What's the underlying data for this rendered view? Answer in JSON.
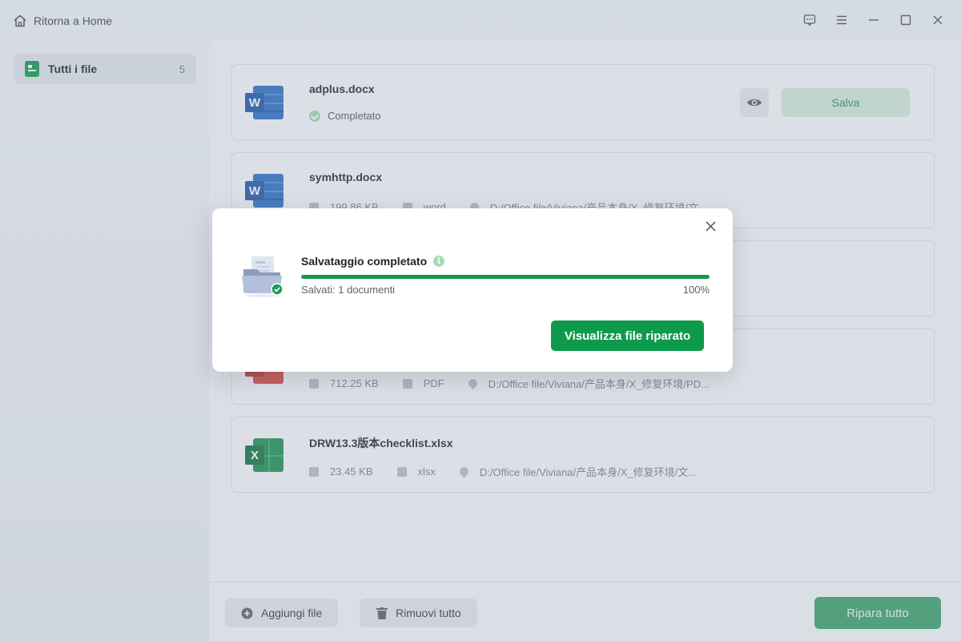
{
  "titlebar": {
    "home_label": "Ritorna a Home",
    "controls": [
      "feedback-icon",
      "menu-icon",
      "minimize-icon",
      "maximize-icon",
      "close-icon"
    ]
  },
  "sidebar": {
    "items": [
      {
        "label": "Tutti i file",
        "count": "5",
        "icon": "file-list-icon"
      }
    ]
  },
  "files": [
    {
      "name": "adplus.docx",
      "type": "word",
      "status": "Completato",
      "save_label": "Salva"
    },
    {
      "name": "symhttp.docx",
      "type": "word",
      "size": "199.86 KB",
      "format": "word",
      "path": "D:/Office file/Viviana/产品本身/X_修复环境/文..."
    },
    {
      "name": "",
      "type": "hidden"
    },
    {
      "name": "",
      "type": "pdf",
      "size": "712.25 KB",
      "format": "PDF",
      "path": "D:/Office file/Viviana/产品本身/X_修复环境/PD..."
    },
    {
      "name": "DRW13.3版本checklist.xlsx",
      "type": "excel",
      "size": "23.45 KB",
      "format": "xlsx",
      "path": "D:/Office file/Viviana/产品本身/X_修复环境/文..."
    }
  ],
  "bottombar": {
    "add_label": "Aggiungi file",
    "remove_label": "Rimuovi tutto",
    "repair_label": "Ripara tutto"
  },
  "modal": {
    "title": "Salvataggio completato",
    "saved_text": "Salvati: 1 documenti",
    "percent_text": "100%",
    "progress": 1.0,
    "button_label": "Visualizza file riparato"
  },
  "colors": {
    "accent": "#0e9a4b",
    "word": "#2b6cc4",
    "excel": "#1d8f4e",
    "pdf": "#d9463e"
  }
}
